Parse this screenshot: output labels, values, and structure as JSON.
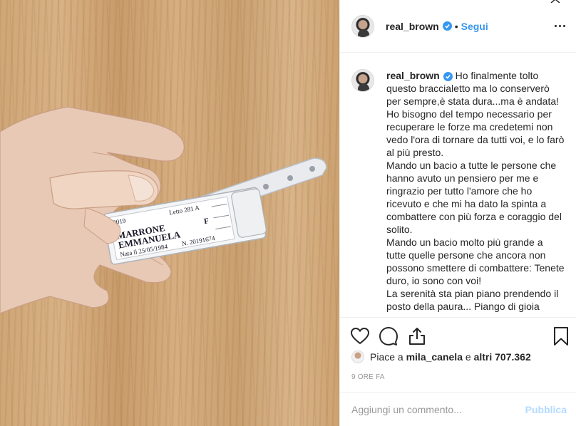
{
  "post": {
    "image_tag": {
      "line1_partial": "2019",
      "bed": "Letto 281 A",
      "surname": "MARRONE",
      "firstname": "EMMANUELA",
      "sex": "F",
      "birth": "Nata il 25/05/1984",
      "number": "N. 20191674"
    }
  },
  "header": {
    "username": "real_brown",
    "separator": "•",
    "follow_label": "Segui",
    "more_icon": "more-horizontal-icon"
  },
  "caption": {
    "username": "real_brown",
    "paragraphs": [
      "Ho finalmente tolto questo braccialetto ma lo conserverò per sempre,è stata dura...ma è andata! Ho bisogno del tempo necessario per recuperare le forze ma credetemi non vedo l'ora di tornare da tutti voi, e lo farò al più presto.",
      "Mando un bacio a tutte le persone che hanno avuto un pensiero per me e ringrazio per tutto l'amore che ho ricevuto e che mi ha dato la spinta a combattere con più forza e coraggio del solito.",
      "Mando un bacio molto più grande a tutte quelle persone che ancora non possono smettere di combattere: Tenete duro, io sono con voi!",
      "La serenità sta pian piano prendendo il posto della paura... Piango di gioia"
    ]
  },
  "actions": {
    "icons": [
      "heart-icon",
      "comment-icon",
      "share-icon",
      "bookmark-icon"
    ]
  },
  "likes": {
    "prefix": "Piace a",
    "user": "mila_canela",
    "suffix": "e",
    "others": "altri 707.362"
  },
  "timestamp": "9 ORE FA",
  "comment": {
    "placeholder": "Aggiungi un commento...",
    "publish_label": "Pubblica"
  },
  "colors": {
    "accent": "#3897f0",
    "publish_disabled": "#b3dbff",
    "muted": "#999999",
    "border": "#efefef"
  }
}
